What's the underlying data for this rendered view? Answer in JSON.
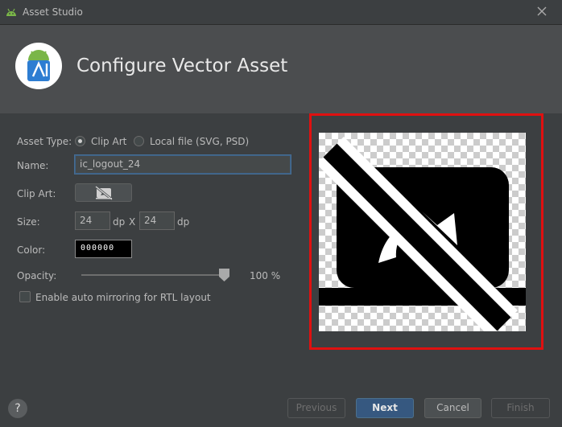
{
  "window": {
    "title": "Asset Studio"
  },
  "header": {
    "heading": "Configure Vector Asset"
  },
  "form": {
    "asset_type": {
      "label": "Asset Type:",
      "options": [
        "Clip Art",
        "Local file (SVG, PSD)"
      ],
      "selected": "Clip Art"
    },
    "name": {
      "label": "Name:",
      "value": "ic_logout_24"
    },
    "clip_art": {
      "label": "Clip Art:",
      "icon": "image-off-icon"
    },
    "size": {
      "label": "Size:",
      "width": "24",
      "height": "24",
      "unit": "dp",
      "separator": "X"
    },
    "color": {
      "label": "Color:",
      "value": "000000"
    },
    "opacity": {
      "label": "Opacity:",
      "value": 100,
      "display": "100 %"
    },
    "rtl": {
      "label": "Enable auto mirroring for RTL layout",
      "checked": false
    }
  },
  "preview": {
    "icon": "image-off-icon",
    "highlight_color": "#e01010"
  },
  "footer": {
    "help": "?",
    "previous": "Previous",
    "next": "Next",
    "cancel": "Cancel",
    "finish": "Finish"
  }
}
